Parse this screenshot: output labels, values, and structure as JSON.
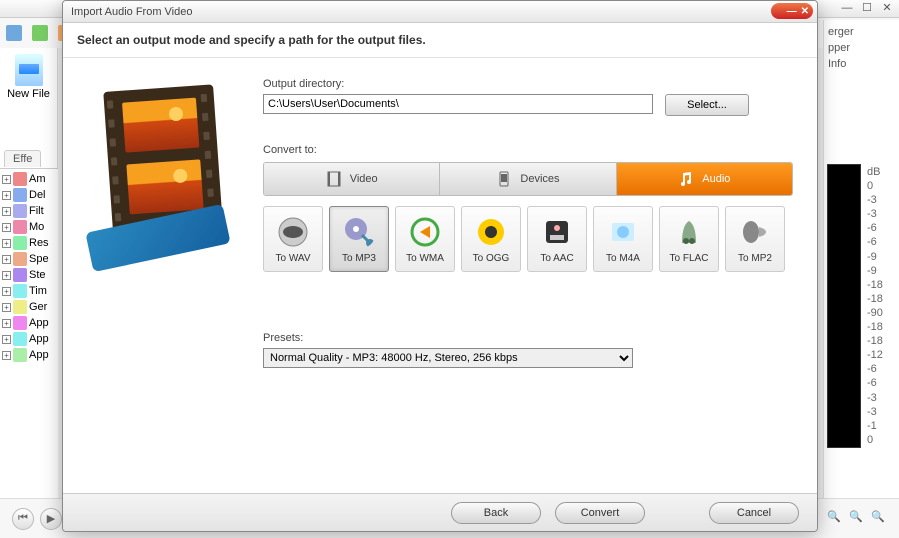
{
  "bg": {
    "newfile_label": "New File",
    "effects_tab": "Effe",
    "tree": [
      {
        "label": "Am",
        "color": "#e88"
      },
      {
        "label": "Del",
        "color": "#8ae"
      },
      {
        "label": "Filt",
        "color": "#aae"
      },
      {
        "label": "Mo",
        "color": "#e8a"
      },
      {
        "label": "Res",
        "color": "#8ea"
      },
      {
        "label": "Spe",
        "color": "#ea8"
      },
      {
        "label": "Ste",
        "color": "#a8e"
      },
      {
        "label": "Tim",
        "color": "#8ee"
      },
      {
        "label": "Ger",
        "color": "#ee8"
      },
      {
        "label": "App",
        "color": "#e8e"
      },
      {
        "label": "App",
        "color": "#8ee"
      },
      {
        "label": "App",
        "color": "#aea"
      }
    ],
    "right_labels": [
      "erger",
      "pper",
      "Info"
    ],
    "scale": [
      "dB",
      "0",
      "-3",
      "-3",
      "-6",
      "-6",
      "-9",
      "-9",
      "-18",
      "-18",
      "-90",
      "-18",
      "-18",
      "-12",
      "-6",
      "-6",
      "-3",
      "-3",
      "-1",
      "0"
    ]
  },
  "dialog": {
    "title": "Import Audio From Video",
    "instruction": "Select an output mode and specify a path for the output files.",
    "output_dir_label": "Output directory:",
    "output_dir_value": "C:\\Users\\User\\Documents\\",
    "select_btn": "Select...",
    "convert_label": "Convert to:",
    "tabs": [
      {
        "label": "Video"
      },
      {
        "label": "Devices"
      },
      {
        "label": "Audio"
      }
    ],
    "formats": [
      {
        "label": "To WAV"
      },
      {
        "label": "To MP3"
      },
      {
        "label": "To WMA"
      },
      {
        "label": "To OGG"
      },
      {
        "label": "To AAC"
      },
      {
        "label": "To M4A"
      },
      {
        "label": "To FLAC"
      },
      {
        "label": "To MP2"
      }
    ],
    "presets_label": "Presets:",
    "preset_value": "Normal Quality - MP3: 48000 Hz, Stereo, 256 kbps",
    "back_btn": "Back",
    "convert_btn": "Convert",
    "cancel_btn": "Cancel"
  }
}
